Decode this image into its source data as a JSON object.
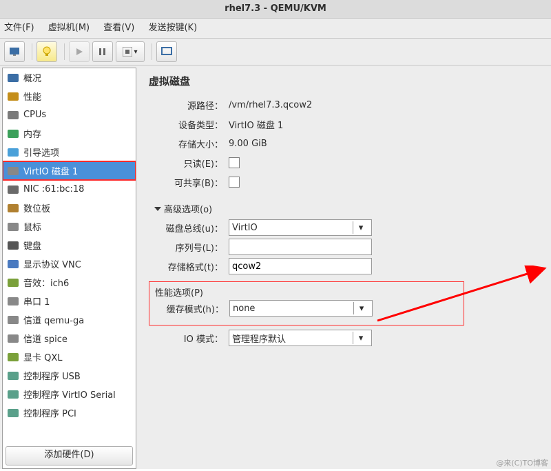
{
  "title": "rhel7.3 - QEMU/KVM",
  "menu": {
    "file": "文件(F)",
    "vm": "虚拟机(M)",
    "view": "查看(V)",
    "sendkey": "发送按键(K)"
  },
  "hw_items": [
    "概况",
    "性能",
    "CPUs",
    "内存",
    "引导选项",
    "VirtIO 磁盘 1",
    "NIC :61:bc:18",
    "数位板",
    "鼠标",
    "键盘",
    "显示协议 VNC",
    "音效：ich6",
    "串口 1",
    "信道 qemu-ga",
    "信道 spice",
    "显卡 QXL",
    "控制程序 USB",
    "控制程序 VirtIO Serial",
    "控制程序 PCI"
  ],
  "selected_index": 5,
  "add_hw": "添加硬件(D)",
  "panel_title": "虚拟磁盘",
  "labels": {
    "source": "源路径：",
    "devtype": "设备类型：",
    "size": "存储大小：",
    "readonly": "只读(E)：",
    "shareable": "可共享(B)：",
    "adv": "高级选项(o)",
    "bus": "磁盘总线(u)：",
    "serial": "序列号(L)：",
    "stfmt": "存储格式(t)：",
    "perf": "性能选项(P)",
    "cache": "缓存模式(h)：",
    "iomode": "IO 模式："
  },
  "values": {
    "source": "/vm/rhel7.3.qcow2",
    "devtype": "VirtIO 磁盘 1",
    "size": "9.00 GiB",
    "bus": "VirtIO",
    "serial": "",
    "stfmt": "qcow2",
    "cache": "none",
    "iomode": "管理程序默认"
  },
  "watermark": "@来(C)TO博客"
}
